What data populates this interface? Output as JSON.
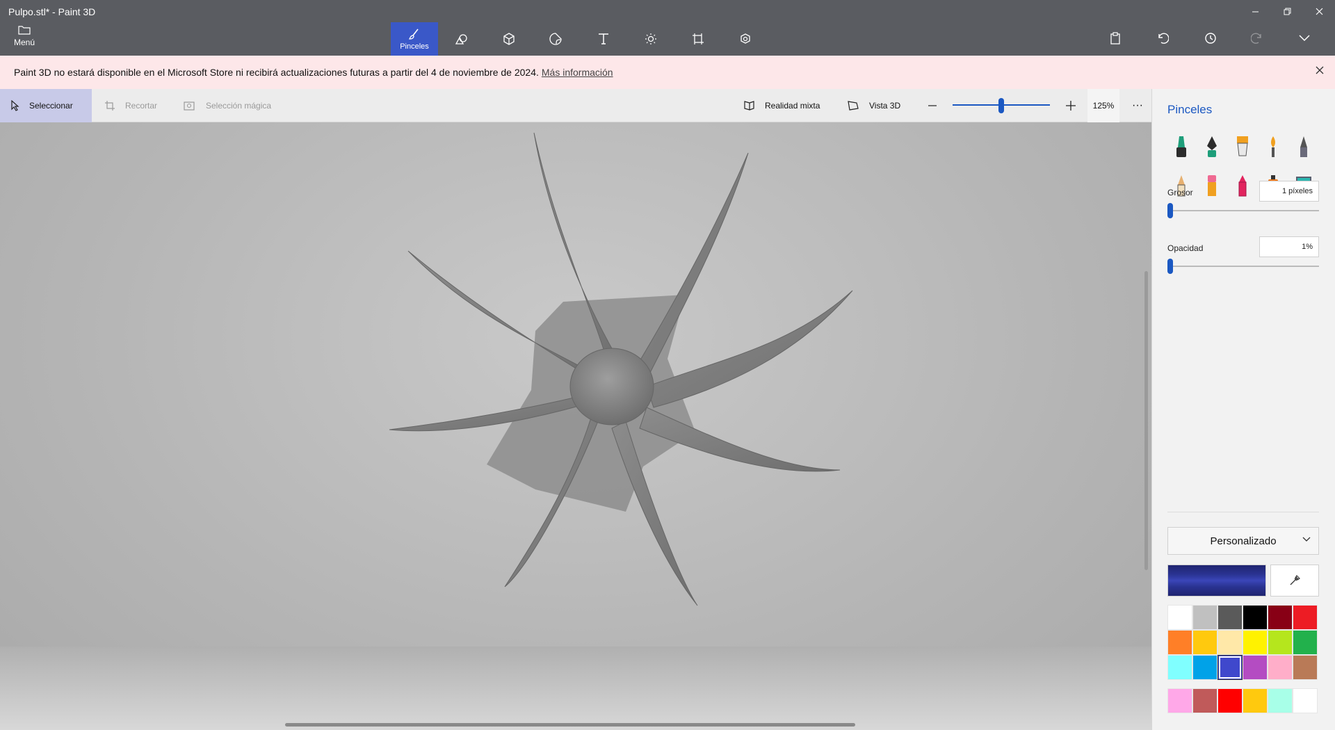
{
  "window": {
    "title": "Pulpo.stl* - Paint 3D",
    "controls": [
      "minimize-icon",
      "restore-icon",
      "close-icon"
    ]
  },
  "menu": {
    "label": "Menú",
    "icon": "folder-icon"
  },
  "toolbar": {
    "tools": [
      {
        "icon": "brush-icon",
        "label": "Pinceles",
        "active": true
      },
      {
        "icon": "shapes-2d-icon",
        "label": "",
        "active": false
      },
      {
        "icon": "shapes-3d-icon",
        "label": "",
        "active": false
      },
      {
        "icon": "stickers-icon",
        "label": "",
        "active": false
      },
      {
        "icon": "text-icon",
        "label": "",
        "active": false
      },
      {
        "icon": "effects-icon",
        "label": "",
        "active": false
      },
      {
        "icon": "canvas-icon",
        "label": "",
        "active": false
      },
      {
        "icon": "library-3d-icon",
        "label": "",
        "active": false
      }
    ],
    "right": [
      "paste-icon",
      "undo-icon",
      "history-icon",
      "redo-icon",
      "expand-icon"
    ]
  },
  "notice": {
    "text": "Paint 3D no estará disponible en el Microsoft Store ni recibirá actualizaciones futuras a partir del 4 de noviembre de 2024.",
    "link": "Más información",
    "bg": "#fde7e9"
  },
  "subbar": {
    "select": "Seleccionar",
    "crop": "Recortar",
    "magic_select": "Selección mágica",
    "mixed_reality": "Realidad mixta",
    "view_3d": "Vista 3D",
    "zoom_value": "125%",
    "zoom_level": 0.5,
    "more": "···"
  },
  "panel": {
    "title": "Pinceles",
    "brushes": [
      {
        "name": "marker-brush-icon",
        "color": "#1e9e7a"
      },
      {
        "name": "calligraphy-pen-icon",
        "color": "#1e9e7a"
      },
      {
        "name": "oil-brush-icon",
        "color": "#f0a020"
      },
      {
        "name": "watercolor-brush-icon",
        "color": "#f0a020"
      },
      {
        "name": "pixel-pen-icon",
        "color": "#6a6a7a"
      },
      {
        "name": "pencil-icon",
        "color": "#e7b070"
      },
      {
        "name": "eraser-icon",
        "color": "#ef6a92"
      },
      {
        "name": "crayon-icon",
        "color": "#e2245e"
      },
      {
        "name": "spray-can-icon",
        "color": "#f07a1c"
      },
      {
        "name": "fill-bucket-icon",
        "color": "#2ab7b0"
      }
    ],
    "thickness_label": "Grosor",
    "thickness_value": "1 píxeles",
    "thickness_level": 0.0,
    "opacity_label": "Opacidad",
    "opacity_value": "1%",
    "opacity_level": 0.0,
    "color_mode": "Personalizado",
    "current_color": "#2a3392",
    "palette": [
      "#ffffff",
      "#c0c0c0",
      "#5a5a5a",
      "#000000",
      "#880015",
      "#ed1c24",
      "#ff7f27",
      "#ffc90e",
      "#ffe8a8",
      "#fff200",
      "#b5e61d",
      "#22b14c",
      "#80ffff",
      "#00a2e8",
      "#3f48cc",
      "#b44cc2",
      "#ffaec9",
      "#b97a57"
    ],
    "selected_swatch": 14,
    "custom_palette": [
      "#ffa8e8",
      "#c05a5a",
      "#ff0000",
      "#ffc90e",
      "#a8ffe8",
      "#ffffff"
    ]
  }
}
